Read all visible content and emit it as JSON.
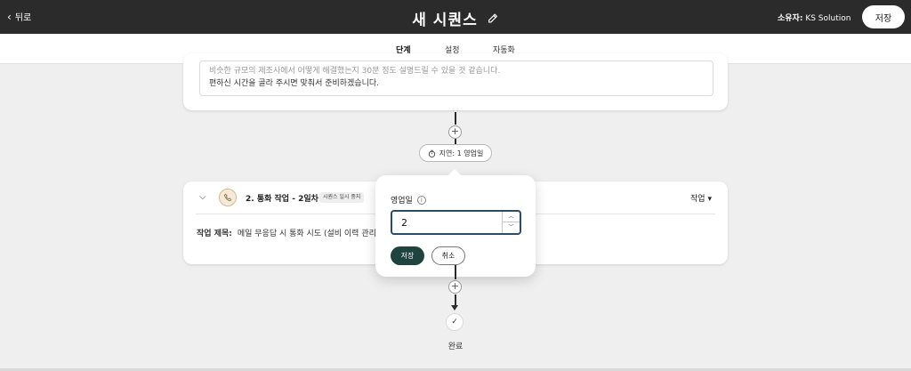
{
  "header": {
    "back_label": "뒤로",
    "title": "새 시퀀스",
    "owner_label": "소유자:",
    "owner_name": "KS Solution",
    "save_label": "저장"
  },
  "tabs": [
    {
      "label": "단계",
      "active": true
    },
    {
      "label": "설정",
      "active": false
    },
    {
      "label": "자동화",
      "active": false
    }
  ],
  "step1": {
    "message_line1": "비슷한 규모의 제조사에서 어떻게 해결했는지 30분 정도 설명드릴 수 있을 것 같습니다.",
    "message_line2": "편하신 시간을 골라 주시면 맞춰서 준비하겠습니다."
  },
  "delay": {
    "label": "지연: 1 영업일",
    "icon": "timer-icon"
  },
  "step2": {
    "title": "2. 통화 작업 - 2일차",
    "badge": "시퀀스 일시 중지",
    "menu_label": "작업",
    "task_title_label": "작업 제목:",
    "task_title_value": "메일 무응답 시 통화 시도 (설비 이력 관리",
    "icon": "phone-icon"
  },
  "popover": {
    "label": "영업일",
    "value": "2",
    "save_label": "저장",
    "cancel_label": "취소"
  },
  "end": {
    "label": "완료"
  },
  "colors": {
    "topbar": "#2b2b2b",
    "primary_button": "#1f4440",
    "input_border": "#2b4b66"
  }
}
